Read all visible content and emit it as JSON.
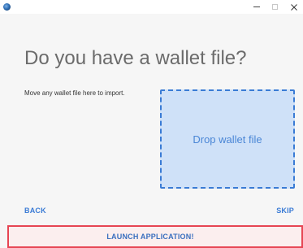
{
  "titlebar": {
    "icon": "app-logo-icon",
    "minimize_glyph": "–",
    "maximize_glyph": "□",
    "close_glyph": "×"
  },
  "main": {
    "heading": "Do you have a wallet file?",
    "hint": "Move any wallet file here to import.",
    "dropzone_label": "Drop wallet file"
  },
  "nav": {
    "back_label": "BACK",
    "skip_label": "SKIP"
  },
  "footer": {
    "launch_label": "LAUNCH APPLICATION!"
  },
  "colors": {
    "accent": "#3a7bd5",
    "dropzone_bg": "#cfe1f8",
    "highlight_border": "#e64553",
    "heading_text": "#6b6b6b"
  }
}
